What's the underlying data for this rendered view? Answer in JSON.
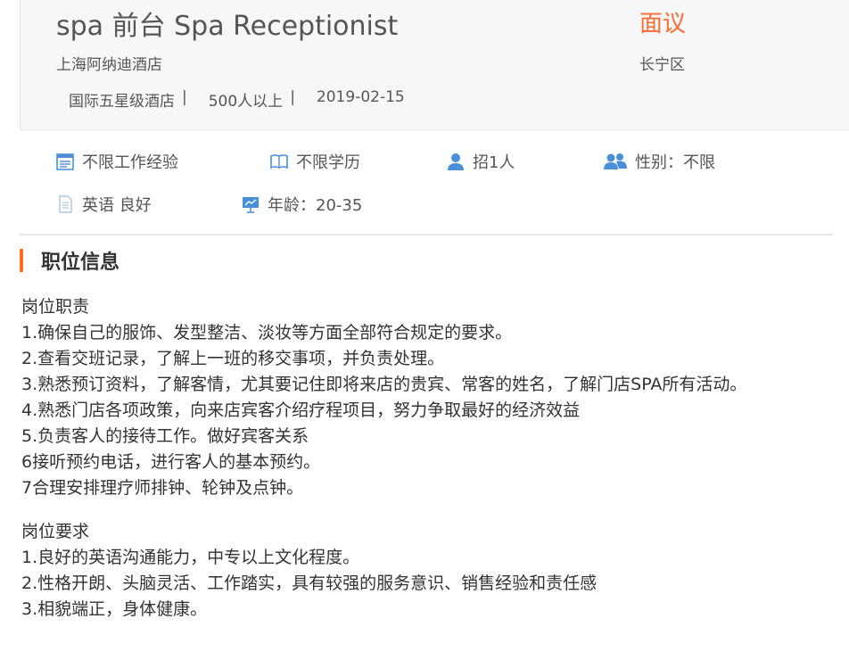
{
  "header": {
    "title": "spa 前台 Spa Receptionist",
    "salary": "面议",
    "company": "上海阿纳迪酒店",
    "district": "长宁区",
    "meta": [
      "国际五星级酒店",
      "500人以上",
      "2019-02-15"
    ],
    "separator": "|"
  },
  "tags": [
    {
      "icon": "calendar-icon",
      "label": "不限工作经验"
    },
    {
      "icon": "book-icon",
      "label": "不限学历"
    },
    {
      "icon": "person-icon",
      "label": "招1人"
    },
    {
      "icon": "people-icon",
      "label": "性别：不限"
    },
    {
      "icon": "document-icon",
      "label": "英语 良好"
    },
    {
      "icon": "presentation-icon",
      "label": "年龄：20-35"
    }
  ],
  "colors": {
    "accent": "#ff6b35",
    "icon": "#4a90d9"
  },
  "section": {
    "title": "职位信息"
  },
  "duties": {
    "heading": "岗位职责",
    "items": [
      "1.确保自己的服饰、发型整洁、淡妆等方面全部符合规定的要求。",
      "2.查看交班记录，了解上一班的移交事项，并负责处理。",
      "3.熟悉预订资料，了解客情，尤其要记住即将来店的贵宾、常客的姓名，了解门店SPA所有活动。",
      "4.熟悉门店各项政策，向来店宾客介绍疗程项目，努力争取最好的经济效益",
      "5.负责客人的接待工作。做好宾客关系",
      "6接听预约电话，进行客人的基本预约。",
      "7合理安排理疗师排钟、轮钟及点钟。"
    ]
  },
  "requirements": {
    "heading": "岗位要求",
    "items": [
      "1.良好的英语沟通能力，中专以上文化程度。",
      "2.性格开朗、头脑灵活、工作踏实，具有较强的服务意识、销售经验和责任感",
      "3.相貌端正，身体健康。"
    ]
  }
}
